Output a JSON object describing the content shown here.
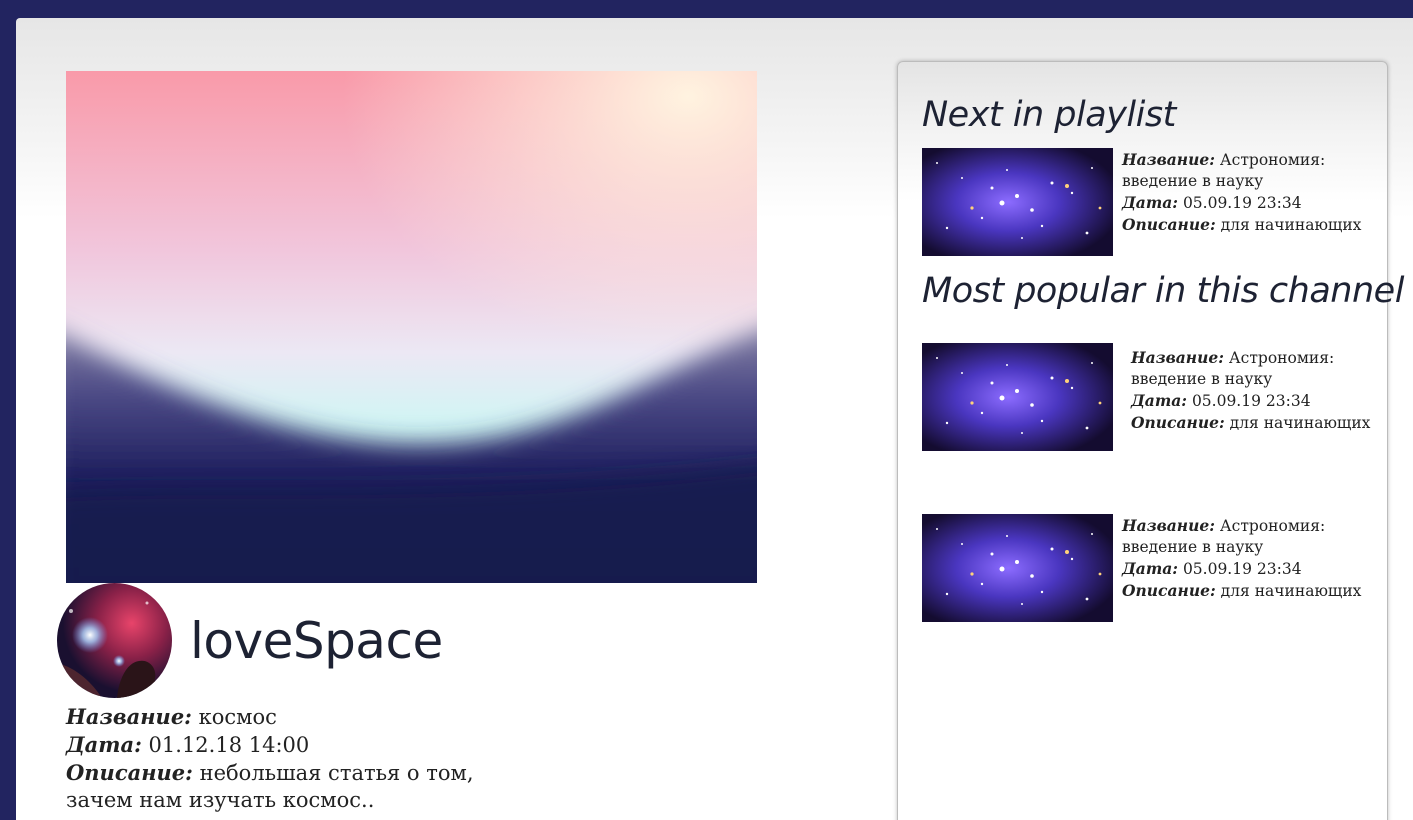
{
  "player": {
    "label": "video-player"
  },
  "channel": {
    "name": "loveSpace"
  },
  "video": {
    "title_label": "Название:",
    "title_value": "космос",
    "date_label": "Дата:",
    "date_value": "01.12.18 14:00",
    "desc_label": "Описание:",
    "desc_value": "небольшая статья о том,",
    "desc_value_2": "зачем нам изучать космос.."
  },
  "sidebar": {
    "playlist_title": "Next in playlist",
    "popular_title": "Most popular in this channel",
    "playlist": [
      {
        "title_label": "Название:",
        "title_value": "Астрономия:",
        "title_value_2": "введение в науку",
        "date_label": "Дата:",
        "date_value": "05.09.19 23:34",
        "desc_label": "Описание:",
        "desc_value": "для начинающих"
      }
    ],
    "popular": [
      {
        "title_label": "Название:",
        "title_value": "Астрономия:",
        "title_value_2": "введение в науку",
        "date_label": "Дата:",
        "date_value": "05.09.19 23:34",
        "desc_label": "Описание:",
        "desc_value": "для начинающих"
      },
      {
        "title_label": "Название:",
        "title_value": "Астрономия:",
        "title_value_2": "введение в науку",
        "date_label": "Дата:",
        "date_value": "05.09.19 23:34",
        "desc_label": "Описание:",
        "desc_value": "для начинающих"
      }
    ]
  },
  "colors": {
    "header_bar": "#222460",
    "text": "#1d2233",
    "thumbnail_space": "#3a2a9a"
  }
}
